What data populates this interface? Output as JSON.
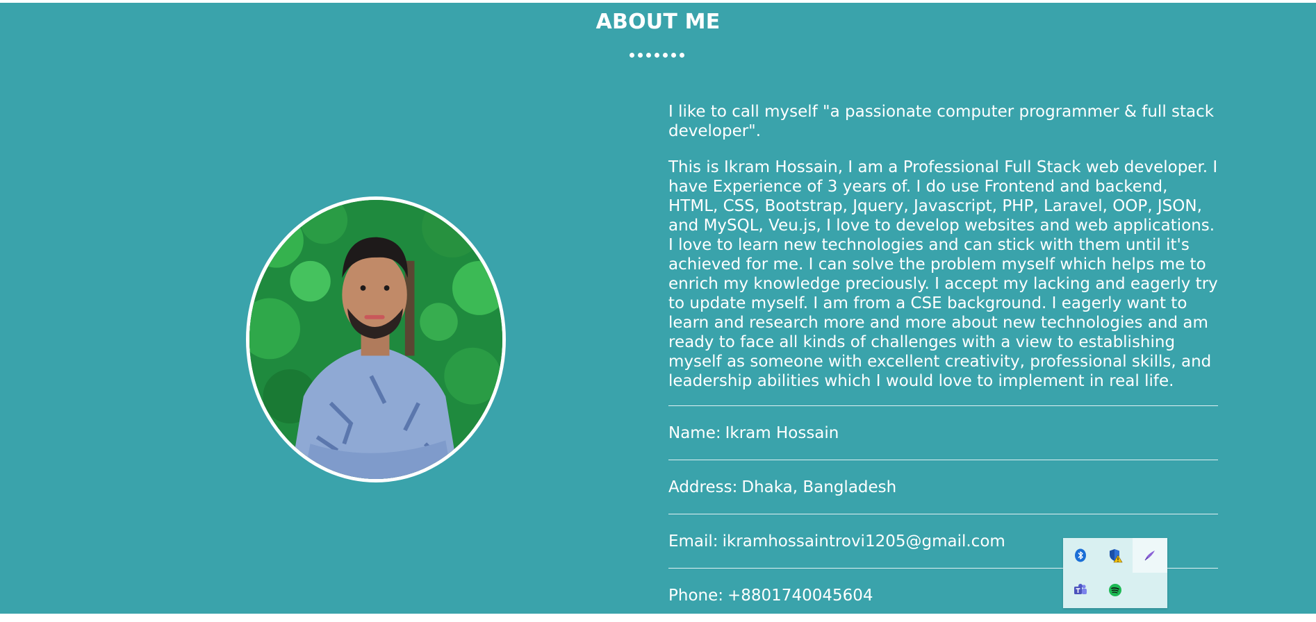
{
  "section": {
    "title": "ABOUT ME"
  },
  "about": {
    "intro": "I like to call myself \"a passionate computer programmer & full stack developer\".",
    "bio": "This is Ikram Hossain, I am a Professional Full Stack web developer. I have Experience of 3 years of. I do use Frontend and backend, HTML, CSS, Bootstrap, Jquery, Javascript, PHP, Laravel, OOP, JSON, and MySQL, Veu.js, I love to develop websites and web applications. I love to learn new technologies and can stick with them until it's achieved for me. I can solve the problem myself which helps me to enrich my knowledge preciously. I accept my lacking and eagerly try to update myself. I am from a CSE background. I eagerly want to learn and research more and more about new technologies and am ready to face all kinds of challenges with a view to establishing myself as someone with excellent creativity, professional skills, and leadership abilities which I would love to implement in real life."
  },
  "info": [
    {
      "label": "Name:",
      "value": "Ikram Hossain"
    },
    {
      "label": "Address:",
      "value": "Dhaka, Bangladesh"
    },
    {
      "label": "Email:",
      "value": "ikramhossaintrovi1205@gmail.com"
    },
    {
      "label": "Phone:",
      "value": "+8801740045604"
    }
  ],
  "tray": {
    "icons": [
      "bluetooth-icon",
      "security-warning-icon",
      "pen-icon",
      "teams-icon",
      "spotify-icon"
    ]
  },
  "colors": {
    "background": "#3aa3ab",
    "text": "#ffffff",
    "tray_background": "#d9f0f1"
  }
}
